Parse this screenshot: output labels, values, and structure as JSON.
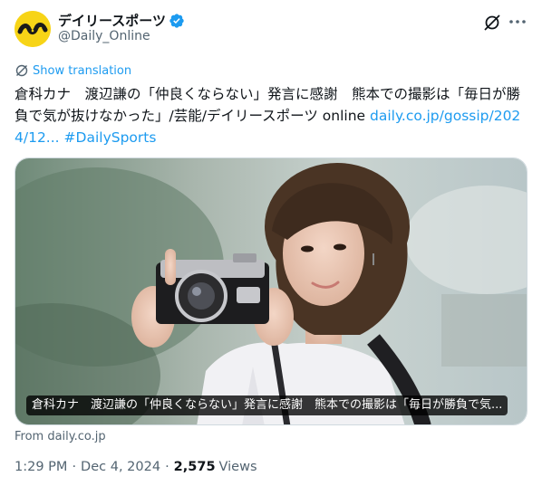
{
  "author": {
    "display_name": "デイリースポーツ",
    "handle": "@Daily_Online",
    "verified": true,
    "avatar_icon": "daily-sports-logo-icon",
    "avatar_color": "#f7d417"
  },
  "header_actions": {
    "grok_icon": "grok-icon",
    "more_icon": "more-options-icon"
  },
  "translation": {
    "label": "Show translation",
    "icon": "translate-icon"
  },
  "tweet": {
    "text": "倉科カナ　渡辺謙の「仲良くならない」発言に感謝　熊本での撮影は「毎日が勝負で気が抜けなかった」/芸能/デイリースポーツ online ",
    "link_text": "daily.co.jp/gossip/2024/12...",
    "hashtag": "#DailySports"
  },
  "card": {
    "caption": "倉科カナ　渡辺謙の「仲良くならない」発言に感謝　熊本での撮影は「毎日が勝負で気...",
    "source": "From daily.co.jp"
  },
  "meta": {
    "time": "1:29 PM",
    "separator": "·",
    "date": "Dec 4, 2024",
    "views_count": "2,575",
    "views_label": "Views"
  },
  "colors": {
    "link": "#1d9bf0",
    "secondary_text": "#536471",
    "primary_text": "#0f1419",
    "border": "#cfd9de"
  }
}
